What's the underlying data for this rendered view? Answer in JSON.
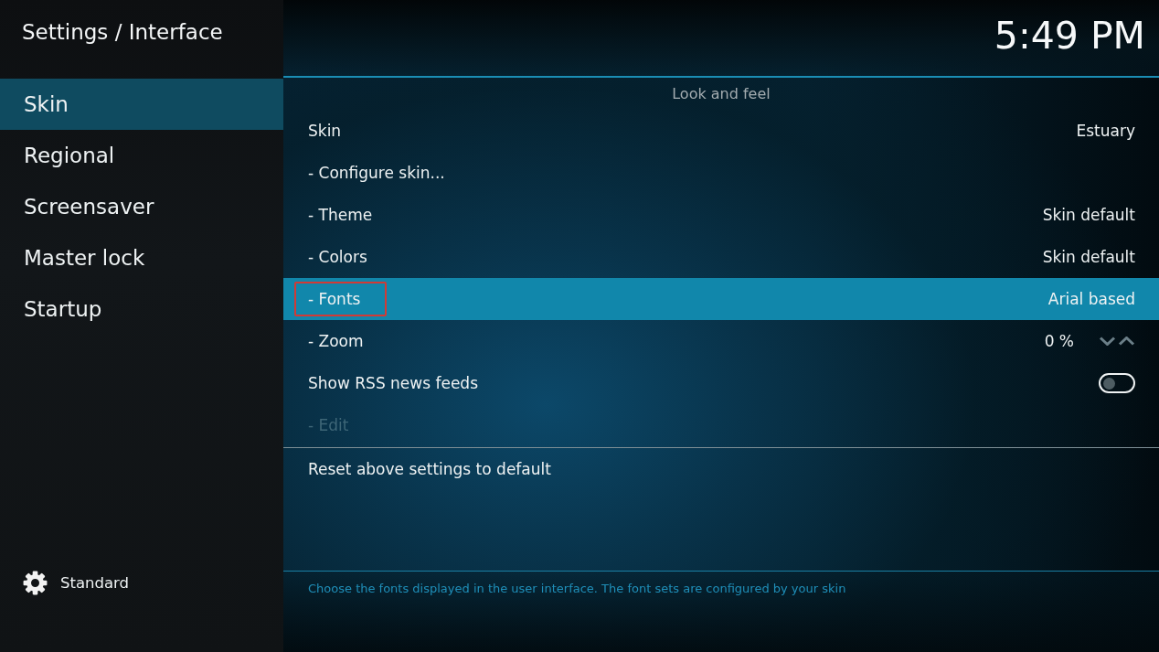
{
  "header": {
    "title": "Settings / Interface",
    "clock": "5:49 PM"
  },
  "sidebar": {
    "items": [
      {
        "label": "Skin",
        "selected": true
      },
      {
        "label": "Regional",
        "selected": false
      },
      {
        "label": "Screensaver",
        "selected": false
      },
      {
        "label": "Master lock",
        "selected": false
      },
      {
        "label": "Startup",
        "selected": false
      }
    ],
    "level_button": {
      "label": "Standard"
    }
  },
  "section": {
    "title": "Look and feel",
    "rows": [
      {
        "kind": "value",
        "label": "Skin",
        "value": "Estuary",
        "selected": false,
        "disabled": false,
        "annotated": false
      },
      {
        "kind": "action",
        "label": "- Configure skin...",
        "selected": false,
        "disabled": false,
        "annotated": false
      },
      {
        "kind": "value",
        "label": "- Theme",
        "value": "Skin default",
        "selected": false,
        "disabled": false,
        "annotated": false
      },
      {
        "kind": "value",
        "label": "- Colors",
        "value": "Skin default",
        "selected": false,
        "disabled": false,
        "annotated": false
      },
      {
        "kind": "value",
        "label": "- Fonts",
        "value": "Arial based",
        "selected": true,
        "disabled": false,
        "annotated": true
      },
      {
        "kind": "spinner",
        "label": "- Zoom",
        "value": "0 %",
        "selected": false,
        "disabled": false,
        "annotated": false
      },
      {
        "kind": "toggle",
        "label": "Show RSS news feeds",
        "on": false,
        "selected": false,
        "disabled": false,
        "annotated": false
      },
      {
        "kind": "action",
        "label": "- Edit",
        "selected": false,
        "disabled": true,
        "annotated": false
      }
    ],
    "reset": {
      "label": "Reset above settings to default"
    }
  },
  "description": "Choose the fonts displayed in the user interface. The font sets are configured by your skin"
}
